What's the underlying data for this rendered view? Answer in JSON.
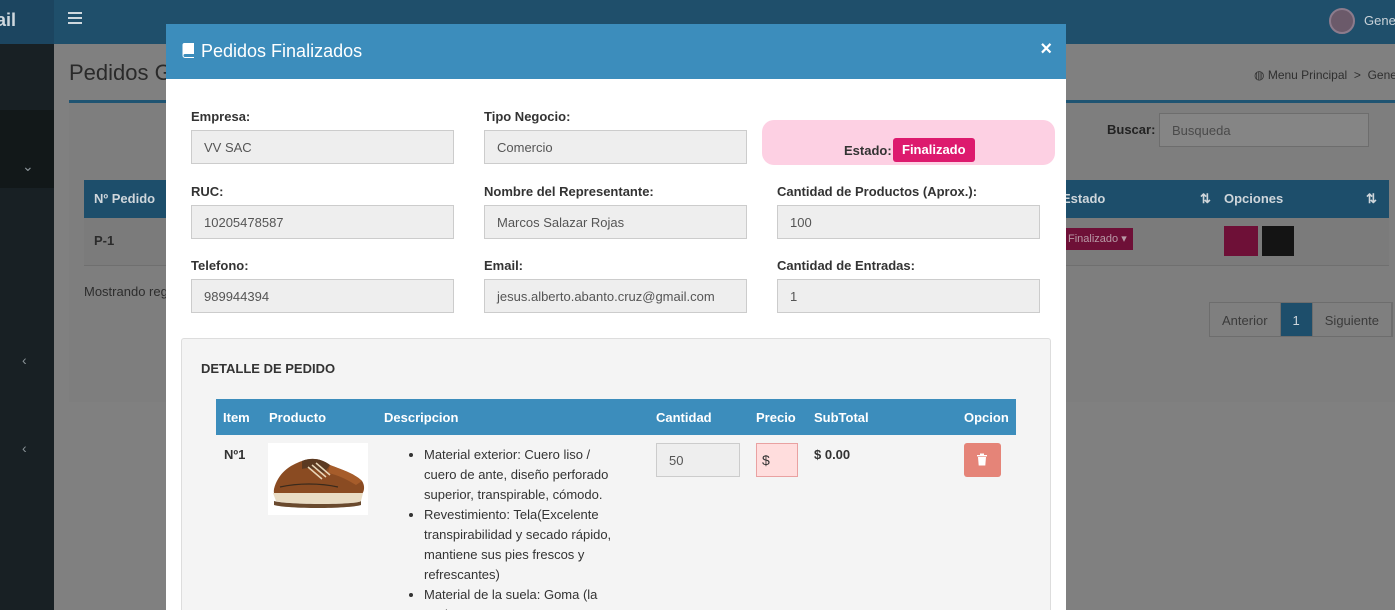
{
  "app": {
    "brand_fragment": "ail",
    "user_name_fragment": "Gene"
  },
  "page": {
    "title_fragment": "Pedidos G",
    "breadcrumb": {
      "home": "Menu Principal",
      "current_fragment": "Gene"
    },
    "search": {
      "label": "Buscar:",
      "placeholder": "Busqueda"
    },
    "table": {
      "headers": {
        "pedido": "Nº Pedido",
        "estado": "Estado",
        "opciones": "Opciones"
      },
      "rows": [
        {
          "pedido": "P-1",
          "estado": "Finalizado"
        }
      ]
    },
    "showing_fragment": "Mostrando reg",
    "pagination": {
      "prev": "Anterior",
      "page": "1",
      "next": "Siguiente"
    }
  },
  "modal": {
    "title": "Pedidos Finalizados",
    "close": "×",
    "fields": {
      "empresa": {
        "label": "Empresa:",
        "value": "VV SAC"
      },
      "tipo_negocio": {
        "label": "Tipo Negocio:",
        "value": "Comercio"
      },
      "ruc": {
        "label": "RUC:",
        "value": "10205478587"
      },
      "representante": {
        "label": "Nombre del Representante:",
        "value": "Marcos Salazar Rojas"
      },
      "cantidad_productos": {
        "label": "Cantidad de Productos (Aprox.):",
        "value": "100"
      },
      "telefono": {
        "label": "Telefono:",
        "value": "989944394"
      },
      "email": {
        "label": "Email:",
        "value": "jesus.alberto.abanto.cruz@gmail.com"
      },
      "cantidad_entradas": {
        "label": "Cantidad de Entradas:",
        "value": "1"
      }
    },
    "estado": {
      "label": "Estado:",
      "value": "Finalizado"
    },
    "detalle": {
      "title": "DETALLE DE PEDIDO",
      "headers": {
        "item": "Item",
        "producto": "Producto",
        "descripcion": "Descripcion",
        "cantidad": "Cantidad",
        "precio": "Precio",
        "subtotal": "SubTotal",
        "opcion": "Opcion"
      },
      "rows": [
        {
          "item": "Nº1",
          "descripcion": [
            "Material exterior: Cuero liso / cuero de ante, diseño perforado superior, transpirable, cómodo.",
            "Revestimiento: Tela(Excelente transpirabilidad y secado rápido, mantiene sus pies frescos y refrescantes)",
            "Material de la suela: Goma (la suela"
          ],
          "cantidad": "50",
          "precio": "$",
          "subtotal": "$ 0.00"
        }
      ]
    }
  },
  "colors": {
    "primary": "#3c8dbc",
    "badge": "#dd1a6e",
    "estado_bg": "#fdd0e3",
    "delete": "#e58478"
  }
}
